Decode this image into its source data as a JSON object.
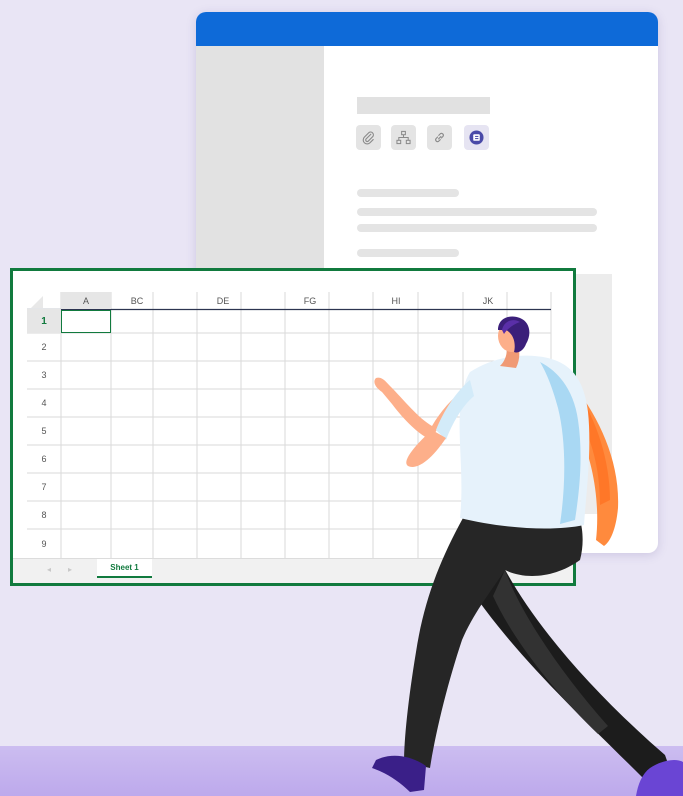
{
  "spreadsheet": {
    "columns": [
      "A",
      "BC",
      "DE",
      "FG",
      "HI",
      "JK"
    ],
    "rows": [
      "1",
      "2",
      "3",
      "4",
      "5",
      "6",
      "7",
      "8",
      "9"
    ],
    "active_row": "1",
    "active_column": "A",
    "sheet_tab": "Sheet 1"
  },
  "document": {
    "toolbar_icons": [
      "paperclip-icon",
      "hierarchy-icon",
      "link-icon",
      "form-icon"
    ]
  },
  "colors": {
    "doc_titlebar": "#0e6ad8",
    "sheet_accent": "#117a3e",
    "background": "#e9e5f5",
    "floor": "#c3b2ee",
    "shirt": "#e6f2fb",
    "pants": "#262626",
    "hair": "#3b1f7a",
    "shoes": "#4b2b9b"
  }
}
